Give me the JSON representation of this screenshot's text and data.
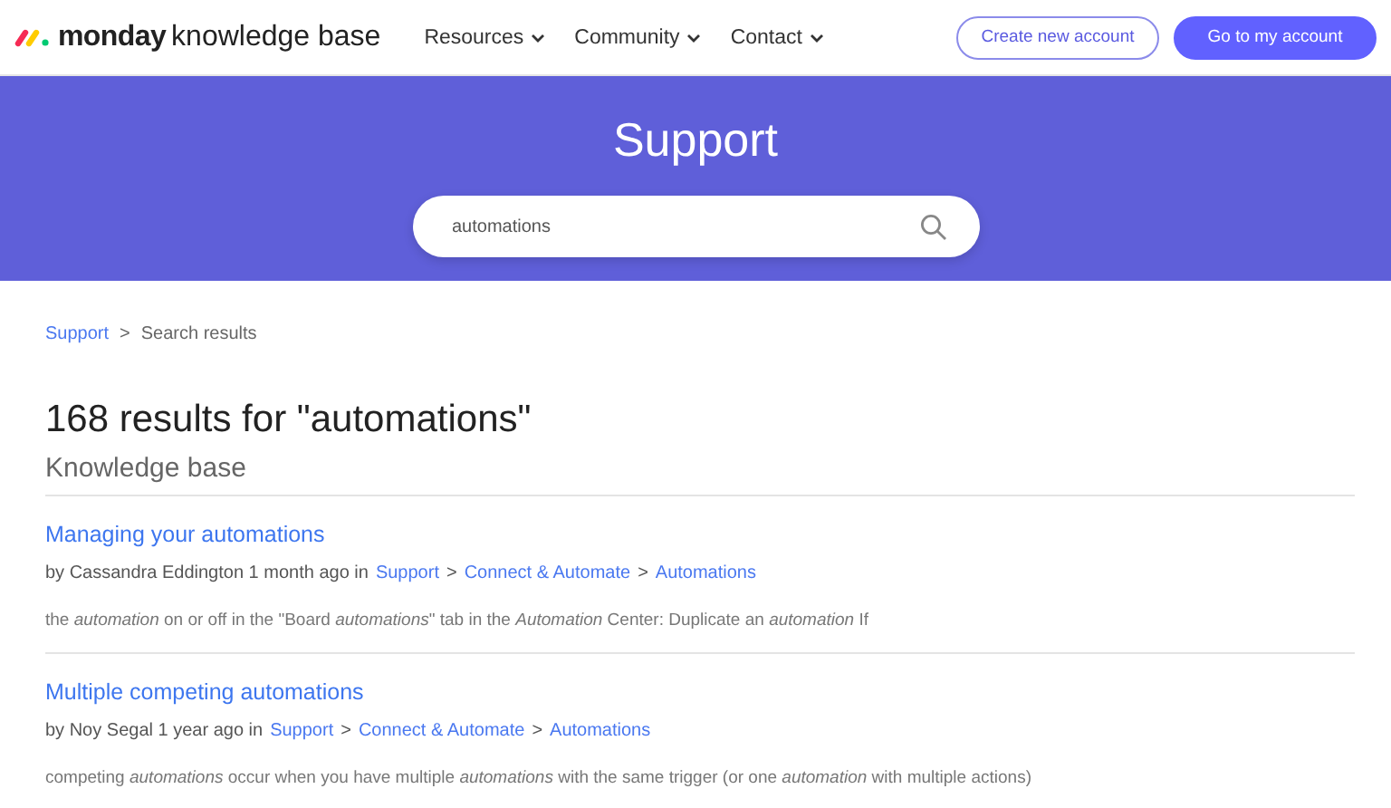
{
  "header": {
    "logo_bold": "monday",
    "logo_rest": "knowledge base",
    "nav": [
      {
        "label": "Resources"
      },
      {
        "label": "Community"
      },
      {
        "label": "Contact"
      }
    ],
    "buttons": [
      {
        "label": "Create new account",
        "kind": "outline"
      },
      {
        "label": "Go to my account",
        "kind": "primary"
      }
    ]
  },
  "hero": {
    "title": "Support",
    "search": {
      "value": "automations"
    }
  },
  "breadcrumb": {
    "items": [
      "Support",
      "Search results"
    ],
    "separator": ">"
  },
  "results_heading": "168 results for \"automations\"",
  "section_title": "Knowledge base",
  "results": [
    {
      "title": "Managing your automations",
      "meta": "by Cassandra Eddington 1 month ago in",
      "path": [
        "Support",
        "Connect & Automate",
        "Automations"
      ],
      "separator": ">",
      "snippet": "the *automation* on or off in the \"Board *automations*\" tab in the *Automation* Center: Duplicate an *automation* If"
    },
    {
      "title": "Multiple competing automations",
      "meta": "by Noy Segal 1 year ago in",
      "path": [
        "Support",
        "Connect & Automate",
        "Automations"
      ],
      "separator": ">",
      "snippet": "competing *automations* occur when you have multiple *automations* with the same trigger (or one *automation* with multiple actions)"
    }
  ]
}
